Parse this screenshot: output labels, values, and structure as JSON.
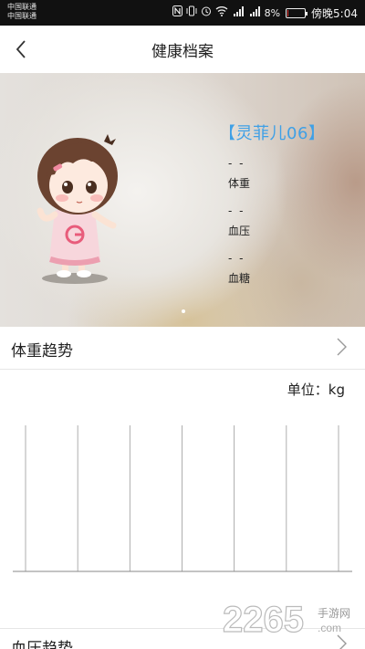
{
  "status_bar": {
    "carrier_1": "中国联通",
    "carrier_2": "中国联通",
    "battery_percent": "8%",
    "battery_level": 0.08,
    "time": "傍晚5:04",
    "icons": [
      "nfc-icon",
      "vibrate-icon",
      "alarm-icon",
      "wifi-icon",
      "signal-4g-icon",
      "signal-3g-icon",
      "battery-icon"
    ]
  },
  "nav": {
    "title": "健康档案"
  },
  "banner": {
    "name": "【灵菲儿06】",
    "weight_value": "- -",
    "weight_label": "体重",
    "bp_value": "- -",
    "bp_label": "血压",
    "sugar_value": "- -",
    "sugar_label": "血糖",
    "page_index": 1,
    "page_count": 1
  },
  "weight_section": {
    "title": "体重趋势",
    "unit": "单位：kg"
  },
  "bp_section": {
    "title": "血压趋势"
  },
  "watermark": {
    "number": "2265",
    "suffix": ".com",
    "tagline": "手游网"
  },
  "chart_data": {
    "type": "line",
    "x": [],
    "series": [],
    "gridlines_vertical": 7,
    "ylabel": "单位：kg",
    "grid": true
  },
  "colors": {
    "accent": "#3fa0e6",
    "battery_low": "#e53935",
    "statusbar": "#111111"
  }
}
